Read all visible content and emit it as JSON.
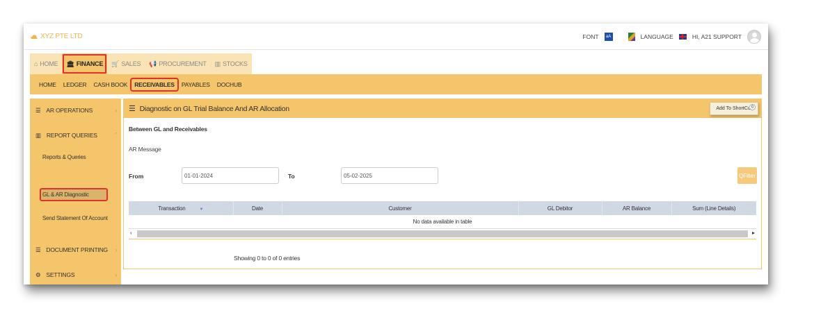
{
  "header": {
    "brand": "XYZ PTE LTD",
    "font_label": "FONT",
    "language_label": "LANGUAGE",
    "user_greeting": "HI, A21 SUPPORT"
  },
  "module_tabs": [
    {
      "label": "HOME",
      "icon": "home-icon",
      "active": false
    },
    {
      "label": "FINANCE",
      "icon": "bank-icon",
      "active": true
    },
    {
      "label": "SALES",
      "icon": "cart-icon",
      "active": false
    },
    {
      "label": "PROCUREMENT",
      "icon": "megaphone-icon",
      "active": false
    },
    {
      "label": "STOCKS",
      "icon": "bar-chart-icon",
      "active": false
    }
  ],
  "sub_nav": [
    {
      "label": "HOME",
      "active": false
    },
    {
      "label": "LEDGER",
      "active": false
    },
    {
      "label": "CASH BOOK",
      "active": false
    },
    {
      "label": "RECEIVABLES",
      "active": true
    },
    {
      "label": "PAYABLES",
      "active": false
    },
    {
      "label": "DOCHUB",
      "active": false
    }
  ],
  "sidebar": {
    "ar_operations": "AR OPERATIONS",
    "report_queries": "REPORT QUERIES",
    "reports_queries": "Reports & Queries",
    "gl_ar_diagnostic": "GL & AR Diagnostic",
    "send_statement": "Send Statement Of Account",
    "document_printing": "DOCUMENT PRINTING",
    "settings": "SETTINGS"
  },
  "panel": {
    "title": "Diagnostic on GL Trial Balance And AR Allocation",
    "shortcut_button": "Add To ShortCut",
    "shortcut_badge": "0",
    "section_title": "Between GL and Receivables",
    "ar_message": "AR Message",
    "from_label": "From",
    "from_value": "01-01-2024",
    "to_label": "To",
    "to_value": "05-02-2025",
    "filter_button": "QFilter"
  },
  "table": {
    "columns": [
      "Transaction",
      "Date",
      "Customer",
      "GL Debitor",
      "AR Balance",
      "Sum (Line Details)"
    ],
    "empty_text": "No data available in table",
    "info": "Showing 0 to 0 of 0 entries"
  },
  "colors": {
    "accent": "#f5c56c",
    "highlight": "#e03030",
    "table_header": "#cfd8e3"
  }
}
